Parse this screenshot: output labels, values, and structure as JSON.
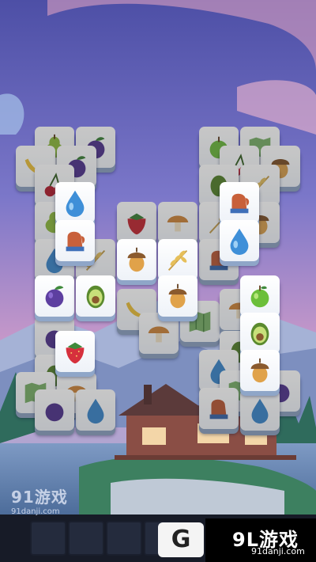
{
  "watermark_left": {
    "logo": "91游戏",
    "url": "91danji.com"
  },
  "brand": {
    "logo": "9L游戏",
    "url": "91danji.com",
    "mark": "G"
  },
  "tray": {
    "slot_count": 5,
    "filled": 0
  },
  "colors": {
    "sky_top": "#5f63b8",
    "sky_pink": "#e9a8c2",
    "tile_face": "#ffffff",
    "tile_edge": "#8fa6c8"
  },
  "tiles_icons": [
    "apple-icon",
    "plum-icon",
    "banana-icon",
    "cherry-icon",
    "water-drop-icon",
    "oven-mitt-icon",
    "acorn-icon",
    "wheat-icon",
    "avocado-icon",
    "strawberry-icon",
    "pear-icon",
    "map-icon",
    "mushroom-icon"
  ]
}
